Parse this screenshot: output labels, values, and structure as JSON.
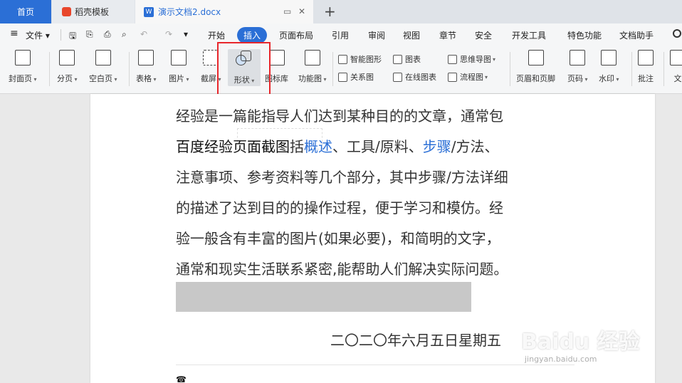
{
  "tabs": {
    "home": "首页",
    "docer": "稻壳模板",
    "document": "演示文档2.docx",
    "document_icon": "W",
    "new_tab": "+"
  },
  "menu": {
    "file": "文件",
    "file_caret": "▾",
    "items": [
      "开始",
      "插入",
      "页面布局",
      "引用",
      "审阅",
      "视图",
      "章节",
      "安全",
      "开发工具",
      "特色功能",
      "文档助手"
    ]
  },
  "ribbon": {
    "cover_page": "封面页",
    "page_break": "分页",
    "blank_page": "空白页",
    "table": "表格",
    "picture": "图片",
    "screenshot": "截屏",
    "shape": "形状",
    "icon_library": "图标库",
    "function_chart": "功能图",
    "smart_graphic": "智能图形",
    "chart": "图表",
    "mind_map": "思维导图",
    "relation_chart": "关系图",
    "online_chart": "在线图表",
    "flowchart": "流程图",
    "header_footer": "页眉和页脚",
    "page_number": "页码",
    "watermark": "水印",
    "comment": "批注",
    "text": "文"
  },
  "document": {
    "lines": [
      "经验是一篇能指导人们达到某种目的的文章，通常包",
      "括",
      "、工具/原料、",
      "/方法、",
      "注意事项、参考资料等几个部分，其中步骤/方法详细",
      "的描述了达到目的的操作过程，便于学习和模仿。经",
      "验一般含有丰富的图片(如果必要)，和简明的文字，",
      "通常和现实生活联系紧密,能帮助人们解决实际问题。"
    ],
    "overlay_title": "百度经验页面截图",
    "link_overview": "概述",
    "link_steps": "步骤",
    "date": "二〇二〇年六月五日星期五",
    "bottom_glyph": "☎"
  },
  "watermark": {
    "brand": "Baidu 经验",
    "url": "jingyan.baidu.com"
  },
  "colors": {
    "accent": "#2b6fd6",
    "highlight_box": "#e8262b",
    "gray_bar": "#c8c8c8"
  }
}
